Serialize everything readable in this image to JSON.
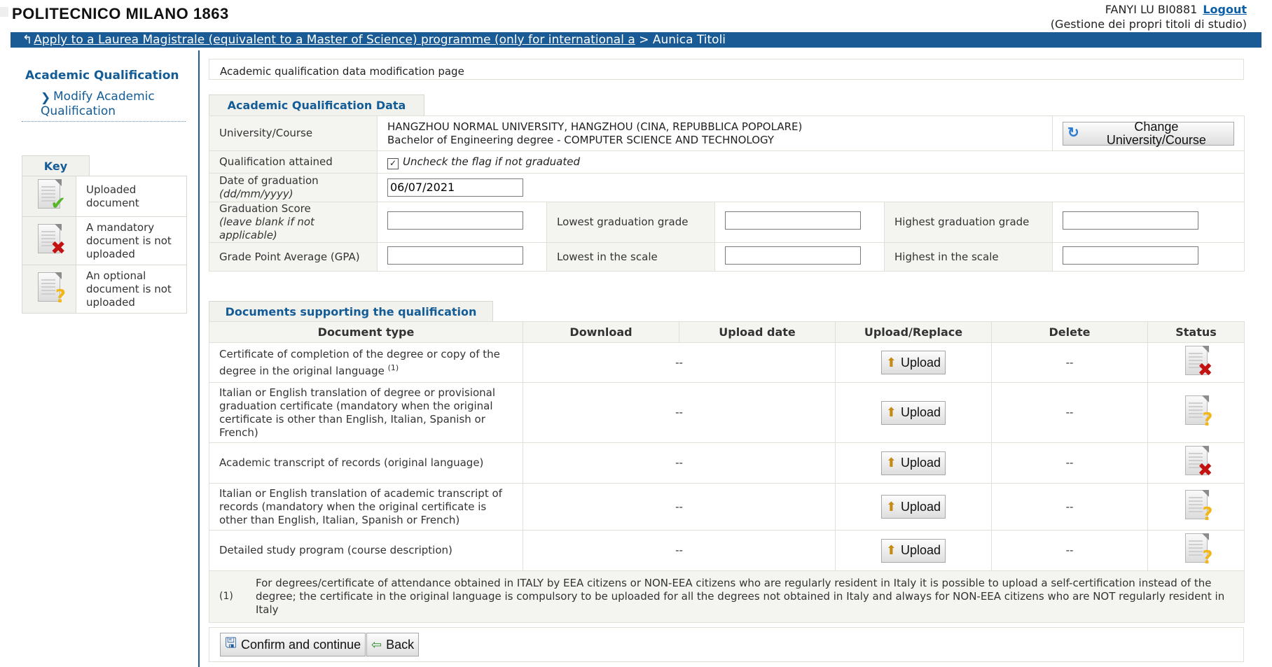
{
  "header": {
    "logo_text": "POLITECNICO MILANO 1863",
    "user_name": "FANYI LU BI0881",
    "logout_label": "Logout",
    "user_subtitle": "(Gestione dei propri titoli di studio)"
  },
  "breadcrumb": {
    "link_text": "Apply to a Laurea Magistrale (equivalent to a Master of Science) programme (only for international a",
    "separator": ">",
    "current": "Aunica Titoli"
  },
  "sidebar": {
    "title": "Academic Qualification",
    "link": "Modify Academic Qualification"
  },
  "key": {
    "title": "Key",
    "items": [
      {
        "label": "Uploaded document",
        "icon": "document-uploaded-icon"
      },
      {
        "label": "A mandatory document is not uploaded",
        "icon": "document-missing-mandatory-icon"
      },
      {
        "label": "An optional document is not uploaded",
        "icon": "document-missing-optional-icon"
      }
    ]
  },
  "main": {
    "intro": "Academic qualification data modification page",
    "aq_section_title": "Academic Qualification Data",
    "university_label": "University/Course",
    "university_value": "HANGZHOU NORMAL UNIVERSITY, HANGZHOU (CINA, REPUBBLICA POPOLARE)",
    "course_value": "Bachelor of Engineering degree - COMPUTER SCIENCE AND TECHNOLOGY",
    "change_button": "Change University/Course",
    "qualification_label": "Qualification attained",
    "qualification_checkbox_text": "Uncheck the flag if not graduated",
    "date_label": "Date of graduation",
    "date_format_hint": "(dd/mm/yyyy)",
    "date_value": "06/07/2021",
    "score_label": "Graduation Score",
    "score_hint": "(leave blank if not applicable)",
    "score_value": "",
    "lowest_grade_label": "Lowest graduation grade",
    "lowest_grade_value": "",
    "highest_grade_label": "Highest graduation grade",
    "highest_grade_value": "",
    "gpa_label": "Grade Point Average (GPA)",
    "gpa_value": "",
    "lowest_scale_label": "Lowest in the scale",
    "lowest_scale_value": "",
    "highest_scale_label": "Highest in the scale",
    "highest_scale_value": ""
  },
  "documents": {
    "section_title": "Documents supporting the qualification",
    "columns": [
      "Document type",
      "Download",
      "Upload date",
      "Upload/Replace",
      "Delete",
      "Status"
    ],
    "rows": [
      {
        "type": "Certificate of completion of the degree or copy of the degree in the original language",
        "note_ref": "(1)",
        "download_date": "--",
        "upload_label": "Upload",
        "delete": "--",
        "status": "missing-mandatory"
      },
      {
        "type": "Italian or English translation of degree or provisional graduation certificate (mandatory when the original certificate is other than English, Italian, Spanish or French)",
        "note_ref": "",
        "download_date": "--",
        "upload_label": "Upload",
        "delete": "--",
        "status": "missing-optional"
      },
      {
        "type": "Academic transcript of records (original language)",
        "note_ref": "",
        "download_date": "--",
        "upload_label": "Upload",
        "delete": "--",
        "status": "missing-mandatory"
      },
      {
        "type": "Italian or English translation of academic transcript of records (mandatory when the original certificate is other than English, Italian, Spanish or French)",
        "note_ref": "",
        "download_date": "--",
        "upload_label": "Upload",
        "delete": "--",
        "status": "missing-optional"
      },
      {
        "type": "Detailed study program (course description)",
        "note_ref": "",
        "download_date": "--",
        "upload_label": "Upload",
        "delete": "--",
        "status": "missing-optional"
      }
    ],
    "footnote_ref": "(1)",
    "footnote_text": "For degrees/certificate of attendance obtained in ITALY by EEA citizens or NON-EEA citizens who are regularly resident in Italy it is possible to upload a self-certification instead of the degree; the certificate in the original language is compulsory to be uploaded for all the degrees not obtained in Italy and always for NON-EEA citizens who are NOT regularly resident in Italy"
  },
  "actions": {
    "confirm_label": "Confirm and continue",
    "back_label": "Back"
  },
  "colors": {
    "nav_bar": "#1a5b96",
    "accent_text": "#135c96",
    "panel_bg": "#f4f4f0"
  }
}
